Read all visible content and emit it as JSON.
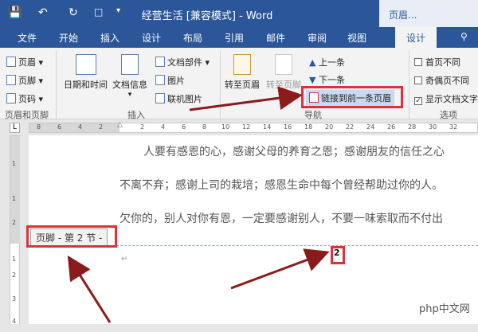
{
  "titlebar": {
    "save_icon": "save-icon",
    "undo_icon": "undo-icon",
    "redo_icon": "redo-icon",
    "touch_icon": "touch-mode-icon",
    "customize_icon": "customize-qat-icon",
    "title": "经营生活 [兼容模式] - Word",
    "context_label": "页眉..."
  },
  "tabs": [
    "文件",
    "开始",
    "插入",
    "设计",
    "布局",
    "引用",
    "邮件",
    "审阅",
    "视图",
    "设计"
  ],
  "tabs_extra_icon": "lightbulb-icon",
  "ribbon": {
    "header_footer": {
      "header": "页眉",
      "footer": "页脚",
      "page_number": "页码",
      "group": "页眉和页脚"
    },
    "insert": {
      "datetime": "日期和时间",
      "docinfo": "文档信息",
      "quickparts": "文档部件",
      "picture": "图片",
      "online_picture": "联机图片",
      "group": "插入"
    },
    "navigation": {
      "goto_header": "转至页眉",
      "goto_footer": "转至页脚",
      "previous": "上一条",
      "next": "下一条",
      "link_previous": "链接到前一条页眉",
      "group": "导航"
    },
    "options": {
      "different_first": "首页不同",
      "different_odd_even": "奇偶页不同",
      "show_doc_text": "显示文档文字",
      "group": "选项",
      "different_first_checked": false,
      "different_odd_even_checked": false,
      "show_doc_text_checked": true
    }
  },
  "ruler": {
    "corner": "L",
    "h_ticks": [
      "8",
      "6",
      "4",
      "2",
      "2",
      "4",
      "6",
      "8",
      "10",
      "12",
      "14",
      "16",
      "18",
      "20",
      "22",
      "24",
      "26",
      "28",
      "30",
      "32"
    ],
    "v_ticks": [
      "1",
      "1",
      "2",
      "1",
      "2",
      "3",
      "4"
    ]
  },
  "document": {
    "lines": [
      "人要有感恩的心，感谢父母的养育之恩；感谢朋友的信任之心",
      "不离不弃；感谢上司的栽培；感恩生命中每个曾经帮助过你的人。",
      "欠你的，别人对你有恩，一定要感谢别人，不要一味索取而不付出"
    ],
    "footer_label": "页脚 - 第 2 节 -",
    "page_number": "2",
    "cursor_mark": "↵"
  },
  "watermark": {
    "text": "php中文网"
  },
  "colors": {
    "word_blue": "#2b579a",
    "annotation_red": "#e0303a",
    "arrow": "#8b1a1a"
  }
}
